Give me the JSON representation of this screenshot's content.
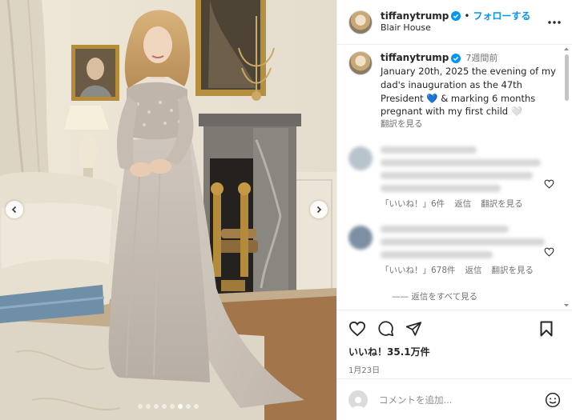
{
  "header": {
    "username": "tiffanytrump",
    "separator": "•",
    "follow_label": "フォローする",
    "location": "Blair House"
  },
  "caption": {
    "username": "tiffanytrump",
    "time": "7週間前",
    "text": "January 20th, 2025 the evening of my dad's inauguration as the 47th President 💙 & marking 6 months pregnant with my first child 🤍",
    "translate_label": "翻訳を見る"
  },
  "comments": [
    {
      "likes_label": "「いいね！」6件",
      "reply_label": "返信",
      "translate_label": "翻訳を見る"
    },
    {
      "likes_label": "「いいね！」678件",
      "reply_label": "返信",
      "translate_label": "翻訳を見る"
    }
  ],
  "view_replies_label": "—— 返信をすべて見る",
  "likes": "いいね！35.1万件",
  "date": "1月23日",
  "comment_input": {
    "placeholder": "コメントを追加..."
  },
  "carousel": {
    "slides": 8,
    "active": 6
  },
  "icons": {
    "more": "more-horizontal-icon",
    "like": "heart-icon",
    "comment": "comment-icon",
    "share": "paper-plane-icon",
    "save": "bookmark-icon",
    "emoji": "smiley-icon",
    "verified": "verified-badge-icon"
  },
  "colors": {
    "accent": "#0095f6",
    "text": "#262626",
    "muted": "#737373",
    "border": "#efefef"
  }
}
